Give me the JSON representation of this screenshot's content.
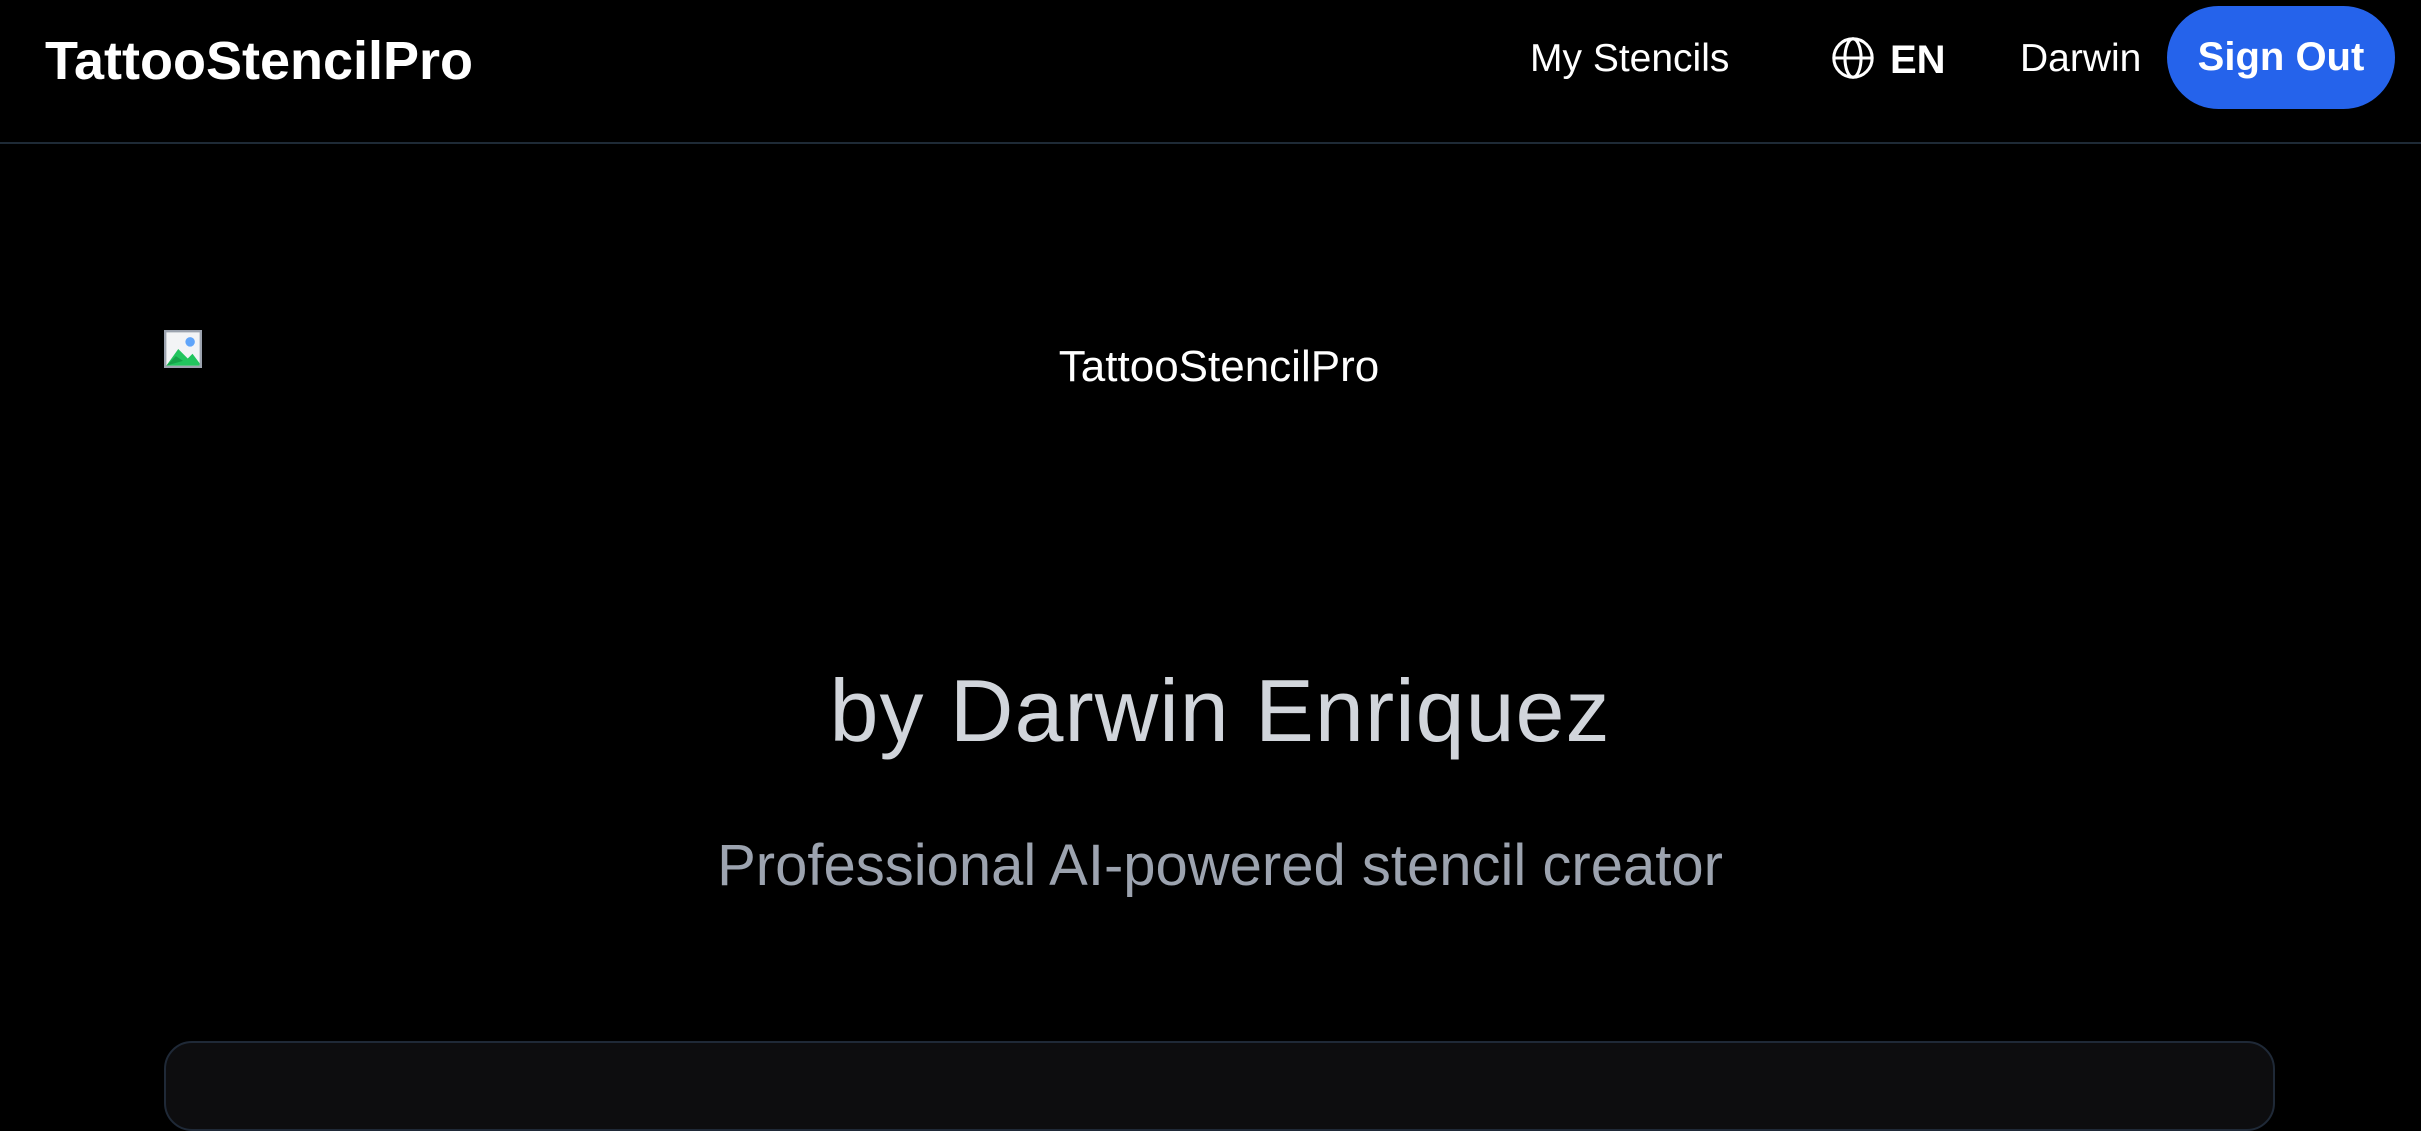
{
  "app": {
    "brand": "TattooStencilPro"
  },
  "nav": {
    "my_stencils": "My Stencils",
    "language": "EN",
    "user": "Darwin",
    "sign_out": "Sign Out"
  },
  "hero": {
    "logo_alt": "TattooStencilPro",
    "byline": "by Darwin Enriquez",
    "tagline": "Professional AI-powered stencil creator"
  },
  "icons": {
    "language": "globe-icon",
    "logo": "broken-image-icon"
  },
  "colors": {
    "background": "#000000",
    "accent": "#2563eb",
    "byline": "#d1d5db",
    "tagline": "#9ca3af"
  }
}
